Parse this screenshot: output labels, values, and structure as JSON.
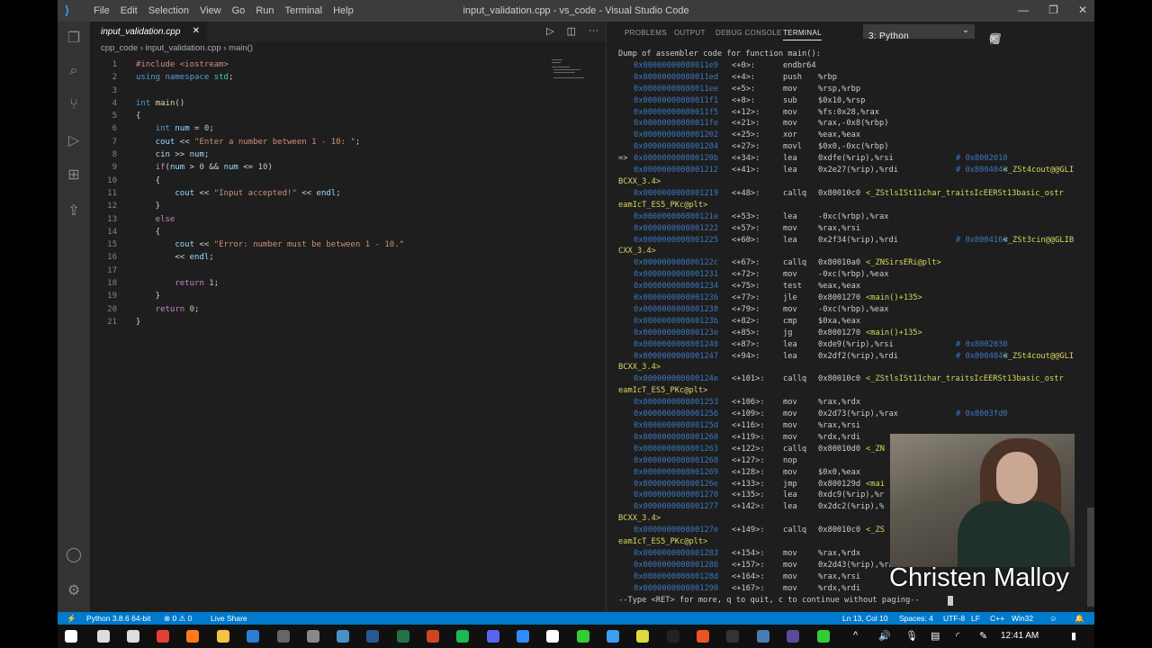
{
  "window": {
    "title": "input_validation.cpp - vs_code - Visual Studio Code",
    "menu": [
      "File",
      "Edit",
      "Selection",
      "View",
      "Go",
      "Run",
      "Terminal",
      "Help"
    ]
  },
  "editor": {
    "tab": "input_validation.cpp",
    "breadcrumb": [
      "cpp_code",
      "input_validation.cpp",
      "main()"
    ],
    "lines": [
      [
        [
          "#include <iostream>",
          "s"
        ]
      ],
      [
        [
          "using ",
          "k"
        ],
        [
          "namespace ",
          "k"
        ],
        [
          "std",
          "t"
        ],
        [
          ";",
          ""
        ]
      ],
      [],
      [
        [
          "int ",
          "k"
        ],
        [
          "main",
          "f"
        ],
        [
          "()",
          ""
        ]
      ],
      [
        [
          "{",
          ""
        ]
      ],
      [
        [
          "    int ",
          "k"
        ],
        [
          "num",
          "v"
        ],
        [
          " = ",
          ""
        ],
        [
          "0",
          "n"
        ],
        [
          ";",
          ""
        ]
      ],
      [
        [
          "    cout",
          "v"
        ],
        [
          " << ",
          ""
        ],
        [
          "\"Enter a number between 1 - 10: \"",
          "s"
        ],
        [
          ";",
          ""
        ]
      ],
      [
        [
          "    cin",
          "v"
        ],
        [
          " >> ",
          ""
        ],
        [
          "num",
          "v"
        ],
        [
          ";",
          ""
        ]
      ],
      [
        [
          "    if",
          "p"
        ],
        [
          "(",
          ""
        ],
        [
          "num",
          "v"
        ],
        [
          " > ",
          ""
        ],
        [
          "0",
          "n"
        ],
        [
          " && ",
          ""
        ],
        [
          "num",
          "v"
        ],
        [
          " <= ",
          ""
        ],
        [
          "10",
          "n"
        ],
        [
          ")",
          ""
        ]
      ],
      [
        [
          "    {",
          ""
        ]
      ],
      [
        [
          "        cout",
          "v"
        ],
        [
          " << ",
          ""
        ],
        [
          "\"Input accepted!\"",
          "s"
        ],
        [
          " << ",
          ""
        ],
        [
          "endl",
          "v"
        ],
        [
          ";",
          ""
        ]
      ],
      [
        [
          "    }",
          ""
        ]
      ],
      [
        [
          "    else",
          "p"
        ]
      ],
      [
        [
          "    {",
          ""
        ]
      ],
      [
        [
          "        cout",
          "v"
        ],
        [
          " << ",
          ""
        ],
        [
          "\"Error: number must be between 1 - 10.\"",
          "s"
        ]
      ],
      [
        [
          "        << ",
          ""
        ],
        [
          "endl",
          "v"
        ],
        [
          ";",
          ""
        ]
      ],
      [],
      [
        [
          "        return ",
          "p"
        ],
        [
          "1",
          "n"
        ],
        [
          ";",
          ""
        ]
      ],
      [
        [
          "    }",
          ""
        ]
      ],
      [
        [
          "    return ",
          "p"
        ],
        [
          "0",
          "n"
        ],
        [
          ";",
          ""
        ]
      ],
      [
        [
          "}",
          ""
        ]
      ]
    ]
  },
  "panel": {
    "tabs": [
      "PROBLEMS",
      "OUTPUT",
      "DEBUG CONSOLE",
      "TERMINAL"
    ],
    "active_tab": "TERMINAL",
    "terminal_select": "3: Python"
  },
  "terminal": {
    "header": "Dump of assembler code for function main():",
    "footer": "--Type <RET> for more, q to quit, c to continue without paging--",
    "rows": [
      [
        "",
        "0x00000000080011e9",
        "<+0>:",
        "endbr64",
        "",
        "",
        ""
      ],
      [
        "",
        "0x00000000080011ed",
        "<+4>:",
        "push",
        "%rbp",
        "",
        ""
      ],
      [
        "",
        "0x00000000080011ee",
        "<+5>:",
        "mov",
        "%rsp,%rbp",
        "",
        ""
      ],
      [
        "",
        "0x00000000080011f1",
        "<+8>:",
        "sub",
        "$0x10,%rsp",
        "",
        ""
      ],
      [
        "",
        "0x00000000080011f5",
        "<+12>:",
        "mov",
        "%fs:0x28,%rax",
        "",
        ""
      ],
      [
        "",
        "0x00000000080011fe",
        "<+21>:",
        "mov",
        "%rax,-0x8(%rbp)",
        "",
        ""
      ],
      [
        "",
        "0x0000000008001202",
        "<+25>:",
        "xor",
        "%eax,%eax",
        "",
        ""
      ],
      [
        "",
        "0x0000000008001204",
        "<+27>:",
        "movl",
        "$0x0,-0xc(%rbp)",
        "",
        ""
      ],
      [
        "=>",
        "0x000000000800120b",
        "<+34>:",
        "lea",
        "0xdfe(%rip),%rsi",
        "# 0x8002010",
        ""
      ],
      [
        "",
        "0x0000000008001212",
        "<+41>:",
        "lea",
        "0x2e27(%rip),%rdi",
        "# 0x8004040",
        "<_ZSt4cout@@GLI"
      ],
      [
        "W",
        "BCXX_3.4>"
      ],
      [
        "",
        "0x0000000008001219",
        "<+48>:",
        "callq",
        "0x80010c0",
        "",
        "<_ZStlsISt11char_traitsIcEERSt13basic_ostr"
      ],
      [
        "W",
        "eamIcT_ES5_PKc@plt>"
      ],
      [
        "",
        "0x000000000800121e",
        "<+53>:",
        "lea",
        "-0xc(%rbp),%rax",
        "",
        ""
      ],
      [
        "",
        "0x0000000008001222",
        "<+57>:",
        "mov",
        "%rax,%rsi",
        "",
        ""
      ],
      [
        "",
        "0x0000000008001225",
        "<+60>:",
        "lea",
        "0x2f34(%rip),%rdi",
        "# 0x8004160",
        "<_ZSt3cin@@GLIB"
      ],
      [
        "W",
        "CXX_3.4>"
      ],
      [
        "",
        "0x000000000800122c",
        "<+67>:",
        "callq",
        "0x80010a0",
        "",
        "<_ZNSirsERi@plt>"
      ],
      [
        "",
        "0x0000000008001231",
        "<+72>:",
        "mov",
        "-0xc(%rbp),%eax",
        "",
        ""
      ],
      [
        "",
        "0x0000000008001234",
        "<+75>:",
        "test",
        "%eax,%eax",
        "",
        ""
      ],
      [
        "",
        "0x0000000008001236",
        "<+77>:",
        "jle",
        "0x8001270",
        "",
        "<main()+135>"
      ],
      [
        "",
        "0x0000000008001238",
        "<+79>:",
        "mov",
        "-0xc(%rbp),%eax",
        "",
        ""
      ],
      [
        "",
        "0x000000000800123b",
        "<+82>:",
        "cmp",
        "$0xa,%eax",
        "",
        ""
      ],
      [
        "",
        "0x000000000800123e",
        "<+85>:",
        "jg",
        "0x8001270",
        "",
        "<main()+135>"
      ],
      [
        "",
        "0x0000000008001240",
        "<+87>:",
        "lea",
        "0xde9(%rip),%rsi",
        "# 0x8002030",
        ""
      ],
      [
        "",
        "0x0000000008001247",
        "<+94>:",
        "lea",
        "0x2df2(%rip),%rdi",
        "# 0x8004040",
        "<_ZSt4cout@@GLI"
      ],
      [
        "W",
        "BCXX_3.4>"
      ],
      [
        "",
        "0x000000000800124e",
        "<+101>:",
        "callq",
        "0x80010c0",
        "",
        "<_ZStlsISt11char_traitsIcEERSt13basic_ostr"
      ],
      [
        "W",
        "eamIcT_ES5_PKc@plt>"
      ],
      [
        "",
        "0x0000000008001253",
        "<+106>:",
        "mov",
        "%rax,%rdx",
        "",
        ""
      ],
      [
        "",
        "0x0000000008001256",
        "<+109>:",
        "mov",
        "0x2d73(%rip),%rax",
        "# 0x8003fd0",
        ""
      ],
      [
        "",
        "0x000000000800125d",
        "<+116>:",
        "mov",
        "%rax,%rsi",
        "",
        ""
      ],
      [
        "",
        "0x0000000008001260",
        "<+119>:",
        "mov",
        "%rdx,%rdi",
        "",
        ""
      ],
      [
        "",
        "0x0000000008001263",
        "<+122>:",
        "callq",
        "0x80010d0",
        "",
        "<_ZN"
      ],
      [
        "",
        "0x0000000008001268",
        "<+127>:",
        "nop",
        "",
        "",
        ""
      ],
      [
        "",
        "0x0000000008001269",
        "<+128>:",
        "mov",
        "$0x0,%eax",
        "",
        ""
      ],
      [
        "",
        "0x000000000800126e",
        "<+133>:",
        "jmp",
        "0x800129d",
        "",
        "<mai"
      ],
      [
        "",
        "0x0000000008001270",
        "<+135>:",
        "lea",
        "0xdc9(%rip),%r",
        "",
        ""
      ],
      [
        "",
        "0x0000000008001277",
        "<+142>:",
        "lea",
        "0x2dc2(%rip),%",
        "",
        ""
      ],
      [
        "W",
        "BCXX_3.4>"
      ],
      [
        "",
        "0x000000000800127e",
        "<+149>:",
        "callq",
        "0x80010c0",
        "",
        "<_ZS"
      ],
      [
        "W",
        "eamIcT_ES5_PKc@plt>"
      ],
      [
        "",
        "0x0000000008001283",
        "<+154>:",
        "mov",
        "%rax,%rdx",
        "",
        ""
      ],
      [
        "",
        "0x0000000008001286",
        "<+157>:",
        "mov",
        "0x2d43(%rip),%rax",
        "",
        ""
      ],
      [
        "",
        "0x000000000800128d",
        "<+164>:",
        "mov",
        "%rax,%rsi",
        "",
        ""
      ],
      [
        "",
        "0x0000000008001290",
        "<+167>:",
        "mov",
        "%rdx,%rdi",
        "",
        ""
      ]
    ]
  },
  "webcam": {
    "name": "Christen Malloy"
  },
  "status": {
    "python": "Python 3.8.6 64-bit",
    "problems": "⊗ 0 ⚠ 0",
    "liveshare": "Live Share",
    "position": "Ln 13, Col 10",
    "spaces": "Spaces: 4",
    "encoding": "UTF-8",
    "eol": "LF",
    "language": "C++",
    "platform": "Win32"
  },
  "taskbar": {
    "time": "12:41 AM"
  }
}
